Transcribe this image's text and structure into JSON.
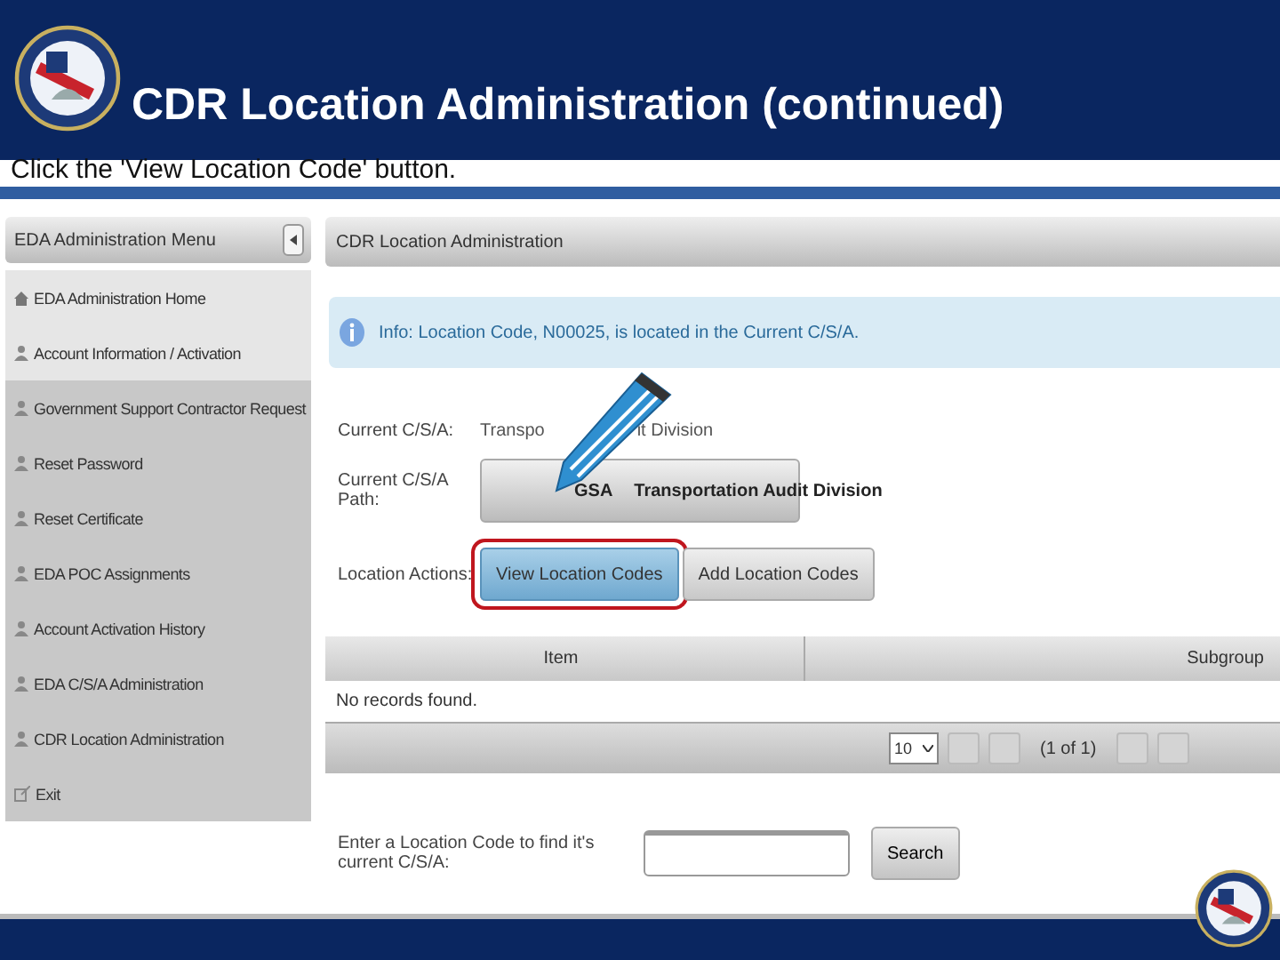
{
  "slide": {
    "title": "CDR Location Administration (continued)",
    "instruction": "Click the 'View Location Code' button."
  },
  "menu": {
    "title": "EDA Administration Menu",
    "items": [
      {
        "label": "EDA Administration Home",
        "kind": "home",
        "highlighted": true
      },
      {
        "label": "Account Information / Activation",
        "kind": "user",
        "highlighted": true
      },
      {
        "label": "Government Support Contractor Request",
        "kind": "user",
        "highlighted": false
      },
      {
        "label": "Reset Password",
        "kind": "user",
        "highlighted": false
      },
      {
        "label": "Reset Certificate",
        "kind": "user",
        "highlighted": false
      },
      {
        "label": "EDA POC Assignments",
        "kind": "user",
        "highlighted": false
      },
      {
        "label": "Account Activation History",
        "kind": "user",
        "highlighted": false
      },
      {
        "label": "EDA C/S/A Administration",
        "kind": "user",
        "highlighted": false
      },
      {
        "label": "CDR Location Administration",
        "kind": "user",
        "highlighted": false
      },
      {
        "label": "Exit",
        "kind": "exit",
        "highlighted": false
      }
    ]
  },
  "panel": {
    "title": "CDR Location Administration",
    "info": "Info: Location Code, N00025, is located in the Current C/S/A.",
    "current_csa": {
      "label": "Current C/S/A:",
      "value_parts": [
        "Transpo",
        "it Division"
      ]
    },
    "path": {
      "label": "Current C/S/A Path:",
      "crumbs": [
        "GSA",
        "Transportation Audit Division"
      ]
    },
    "actions": {
      "label": "Location Actions:",
      "buttons": [
        {
          "label": "View Location Codes",
          "selected": true
        },
        {
          "label": "Add Location Codes",
          "selected": false
        }
      ]
    },
    "table": {
      "columns": [
        "Item",
        "Subgroup"
      ],
      "empty": "No records found.",
      "page_size": "10",
      "page_info": "(1 of 1)"
    },
    "lookup": {
      "label": "Enter a Location Code to find it's current C/S/A:",
      "button": "Search"
    }
  }
}
